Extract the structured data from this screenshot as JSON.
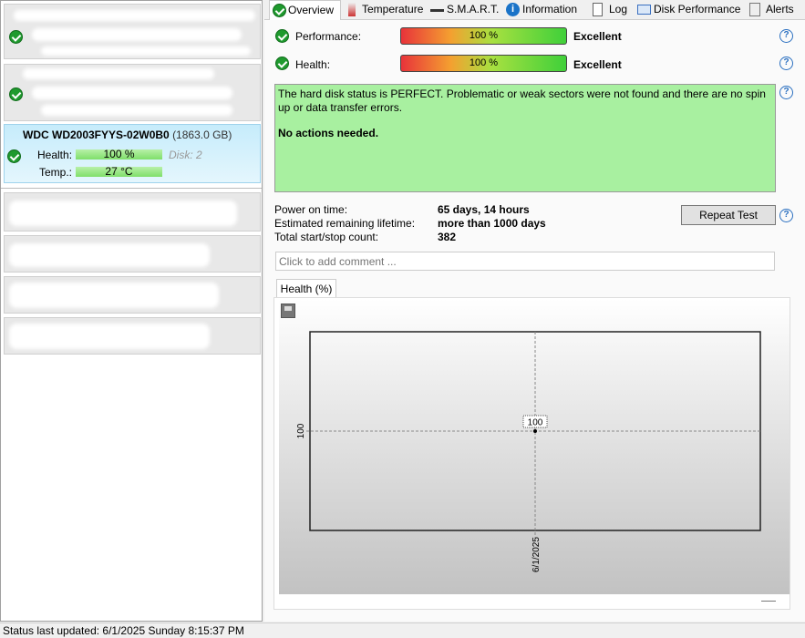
{
  "tabs": [
    {
      "label": "Overview",
      "icon": "check-circle-icon"
    },
    {
      "label": "Temperature",
      "icon": "thermometer-icon"
    },
    {
      "label": "S.M.A.R.T.",
      "icon": "dash-icon"
    },
    {
      "label": "Information",
      "icon": "info-icon"
    },
    {
      "label": "Log",
      "icon": "document-icon"
    },
    {
      "label": "Disk Performance",
      "icon": "chart-icon"
    },
    {
      "label": "Alerts",
      "icon": "alerts-icon"
    }
  ],
  "selected_disk": {
    "name": "WDC WD2003FYYS-02W0B0",
    "size": "(1863.0 GB)",
    "health_label": "Health:",
    "health_value": "100 %",
    "temp_label": "Temp.:",
    "temp_value": "27 °C",
    "disk_label": "Disk: 2"
  },
  "overview": {
    "performance_label": "Performance:",
    "performance_value": "100 %",
    "performance_rating": "Excellent",
    "performance_percent": 100,
    "health_label": "Health:",
    "health_value": "100 %",
    "health_rating": "Excellent",
    "health_percent": 100,
    "status_text": "The hard disk status is PERFECT. Problematic or weak sectors were not found and there are no spin up or data transfer errors.",
    "actions_text": "No actions needed.",
    "power_on_label": "Power on time:",
    "power_on_value": "65 days, 14 hours",
    "lifetime_label": "Estimated remaining lifetime:",
    "lifetime_value": "more than 1000 days",
    "startstop_label": "Total start/stop count:",
    "startstop_value": "382",
    "repeat_test": "Repeat Test",
    "comment_placeholder": "Click to add comment ..."
  },
  "chart_tab": "Health (%)",
  "chart_data": {
    "type": "line",
    "x": [
      "6/1/2025"
    ],
    "values": [
      100
    ],
    "ytick": "100",
    "data_label": "100",
    "xlabel": "",
    "ylabel": ""
  },
  "status_bar": "Status last updated: 6/1/2025 Sunday 8:15:37 PM",
  "colors": {
    "ok_green": "#1f9a2e",
    "status_box": "#a8f0a0",
    "selected": "#c6ecfb"
  }
}
